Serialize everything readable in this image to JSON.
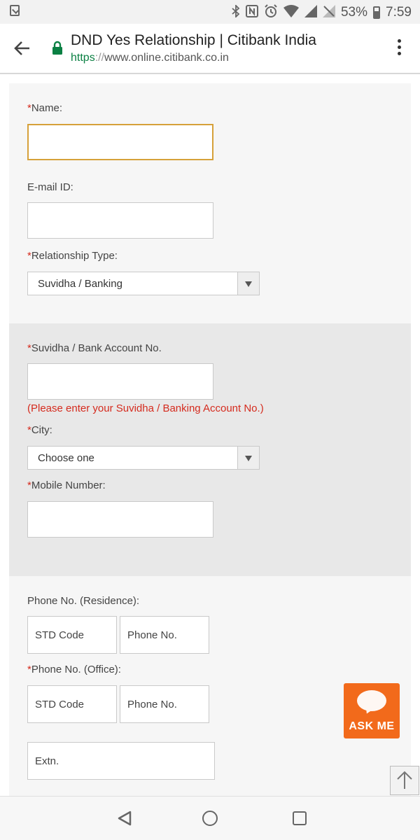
{
  "status_bar": {
    "battery_percent": "53%",
    "time": "7:59",
    "icons": [
      "download-icon",
      "bluetooth-icon",
      "nfc-icon",
      "alarm-icon",
      "wifi-icon",
      "signal-icon",
      "no-sim-icon",
      "battery-icon"
    ]
  },
  "browser": {
    "page_title": "DND Yes Relationship | Citibank India",
    "url_scheme": "https",
    "url_sep": "://",
    "url_host": "www.online.citibank.co.in",
    "colors": {
      "secure": "#0b8043"
    }
  },
  "form": {
    "required_mark": "*",
    "name_label": "Name:",
    "email_label": "E-mail ID:",
    "relationship_label": "Relationship Type:",
    "relationship_value": "Suvidha / Banking",
    "account_label": "Suvidha / Bank Account No.",
    "account_hint": "(Please enter your Suvidha / Banking Account No.)",
    "city_label": "City:",
    "city_value": "Choose one",
    "mobile_label": "Mobile Number:",
    "phone_res_label": "Phone No. (Residence):",
    "phone_off_label": "Phone No. (Office):",
    "std_placeholder": "STD Code",
    "phone_placeholder": "Phone No.",
    "extn_placeholder": "Extn."
  },
  "ask_me": {
    "label": "ASK ME",
    "color": "#f26a1b"
  }
}
